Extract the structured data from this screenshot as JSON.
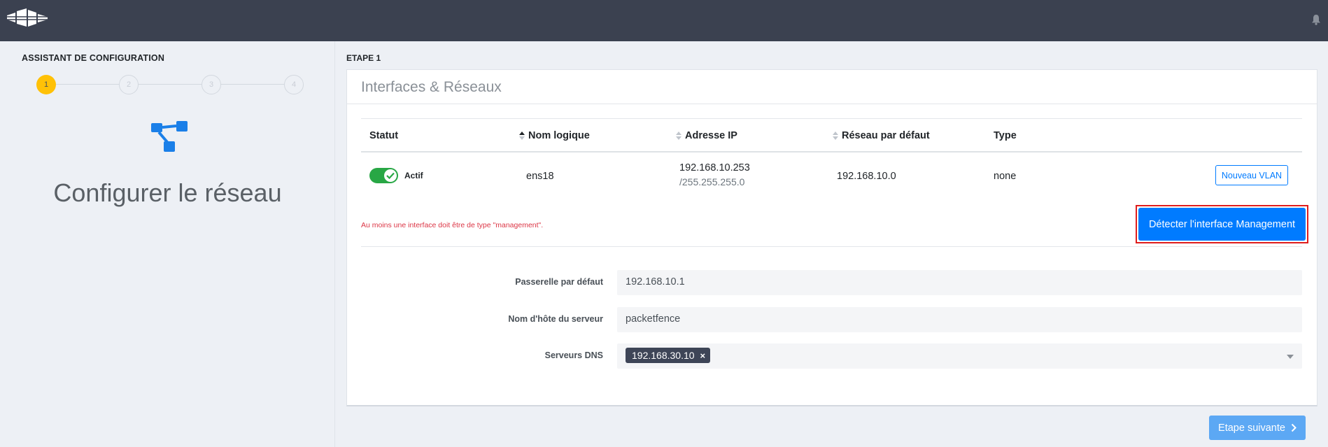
{
  "topbar": {},
  "sidebar": {
    "title": "ASSISTANT DE CONFIGURATION",
    "steps": [
      "1",
      "2",
      "3",
      "4"
    ],
    "active_step": 1,
    "heading": "Configurer le réseau"
  },
  "main": {
    "step_label": "ETAPE 1",
    "card_title": "Interfaces & Réseaux",
    "table": {
      "columns": [
        "Statut",
        "Nom logique",
        "Adresse IP",
        "Réseau par défaut",
        "Type"
      ],
      "rows": [
        {
          "status": "Actif",
          "name": "ens18",
          "ip": "192.168.10.253",
          "mask": "/255.255.255.0",
          "network": "192.168.10.0",
          "type": "none",
          "action": "Nouveau VLAN"
        }
      ]
    },
    "warning": "Au moins une interface doit être de type \"management\".",
    "detect_button": "Détecter l'interface Management",
    "form": {
      "gateway_label": "Passerelle par défaut",
      "gateway_value": "192.168.10.1",
      "hostname_label": "Nom d'hôte du serveur",
      "hostname_value": "packetfence",
      "dns_label": "Serveurs DNS",
      "dns_values": [
        "192.168.30.10"
      ],
      "dns_remove": "×"
    },
    "next_button": "Etape suivante"
  },
  "colors": {
    "topbar": "#3b4150",
    "accent": "#007bff",
    "active_step": "#ffc107",
    "toggle_on": "#28a745",
    "warning": "#dc3545",
    "highlight": "#e01c1c"
  },
  "icons": [
    "packetfence-logo-icon",
    "bell-icon",
    "network-icon",
    "check-icon",
    "sort-icon",
    "chevron-right-icon",
    "chevron-down-icon"
  ]
}
